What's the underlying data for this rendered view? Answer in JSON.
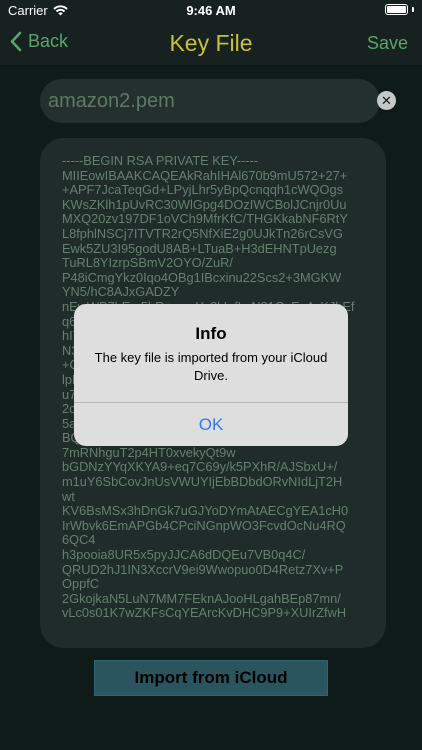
{
  "status_bar": {
    "carrier": "Carrier",
    "time": "9:46 AM",
    "battery_level": 1.0
  },
  "nav": {
    "back_label": "Back",
    "title": "Key File",
    "save_label": "Save"
  },
  "filename": {
    "value": "amazon2.pem"
  },
  "key_content": "-----BEGIN RSA PRIVATE KEY-----\nMIIEowIBAAKCAQEAkRahIHAl670b9mU572+27+\n+APF7JcaTeqGd+LPyjLhr5yBpQcnqqh1cWQOgs\nKWsZKlh1pUvRC30WlGpg4DOzIWCBolJCnjr0Uu\nMXQ20zv197DF1oVCh9MfrKfC/THGKkabNF6RtY\nL8fphlNSCj7ITVTR2rQ5NfXiE2g0UJkTn26rCsVG\nEwk5ZU3I95godU8AB+LTuaB+H3dEHNTpUezg\nTuRL8YIzrpSBmV2OYO/ZuR/\nP48iCmgYkz0Iqo4OBg1IBcxinu22Scs2+3MGKW\nYN5/hC8AJxGADZY\nnEwWB7bEm5bR+nwqYp8kIafLsN81GcEx4eKJbEf\nq6VfT3Q7tMXyTeXfXg9kdGlKKsrmENCy6MpfMw\nhI7PAYuWE8kFh5A3x8G+zLkEWKMf8Lz0fKHr\nN3JNk7dQq8gEY+PpcuKVfQ7JP9cTZyCOVeTI9\n+QGnSC8J7akOg2+lN2pZLQp0mIyM8lzAWrNR7\nlpRwdXh9WBh6QkFqfzsRYxZ1V+hTrYlIHqq3\nu7FFLvUQyT0wH4a9qLpvYx2dEw3lNC8fYtBd\n2cV5JpH0+SEjEm1V3QuTr9WxK+6KHlm2Ddsz\n5aLG1eJfZkhzYeVl2hpUeS7HwFG3eyPAS0\nBQtgjAHLhw2Wo+tkHPpvw7cezQp/\n7mRNhguT2p4HT0xvekyQt9w\nbGDNzYYqXKYA9+eq7C69y/k5PXhR/AJSbxU+/\nm1uY6SbCovJnUsVWUYIjEbBDbdORvNIdLjT2H\nwt\nKV6BsMSx3hDnGk7uGJYoDYmAtAECgYEA1cH0\nIrWbvk6EmAPGb4CPciNGnpWO3FcvdOcNu4RQ\n6QC4\nh3pooia8UR5x5pyJJCA6dDQEu7VB0q4C/\nQRUD2hJ1IN3XccrV9ei9Wwopuo0D4Retz7Xv+P\nOppfC\n2GkojkaN5LuN7MM7FEknAJooHLgahBEp87mn/\nvLc0s01K7wZKFsCqYEArcKvDHC9P9+XUIrZfwH",
  "import_button": {
    "label": "Import from iCloud"
  },
  "alert": {
    "title": "Info",
    "message": "The key file is imported from your iCloud Drive.",
    "ok_label": "OK"
  },
  "colors": {
    "background": "#0e1b18",
    "nav_title": "#c8bf3a",
    "nav_action": "#5aa56e",
    "alert_action": "#2b7cf1"
  }
}
